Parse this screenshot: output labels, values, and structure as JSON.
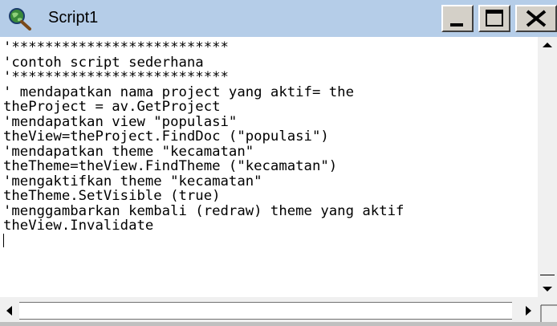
{
  "window": {
    "title": "Script1",
    "icon": "magnifier-globe-icon",
    "controls": {
      "minimize": "minimize-icon",
      "maximize": "maximize-icon",
      "close": "close-icon"
    }
  },
  "editor": {
    "lines": [
      "'**************************",
      "'contoh script sederhana",
      "'**************************",
      "' mendapatkan nama project yang aktif= the",
      "theProject = av.GetProject",
      "'mendapatkan view \"populasi\"",
      "theView=theProject.FindDoc (\"populasi\")",
      "'mendapatkan theme \"kecamatan\"",
      "theTheme=theView.FindTheme (\"kecamatan\")",
      "'mengaktifkan theme \"kecamatan\"",
      "theTheme.SetVisible (true)",
      "'menggambarkan kembali (redraw) theme yang aktif",
      "theView.Invalidate"
    ]
  },
  "scrollbars": {
    "up": "scroll-up-arrow-icon",
    "down": "scroll-down-arrow-icon",
    "left": "scroll-left-arrow-icon",
    "right": "scroll-right-arrow-icon"
  }
}
